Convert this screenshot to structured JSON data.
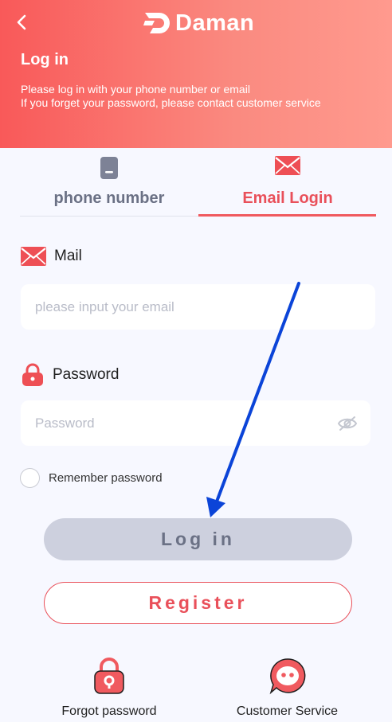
{
  "header": {
    "logo_text": "Daman",
    "title": "Log in",
    "subtitle_line1": "Please log in with your phone number or email",
    "subtitle_line2": "If you forget your password, please contact customer service"
  },
  "tabs": [
    {
      "label": "phone number",
      "active": false
    },
    {
      "label": "Email Login",
      "active": true
    }
  ],
  "mail": {
    "label": "Mail",
    "placeholder": "please input your email",
    "value": ""
  },
  "password": {
    "label": "Password",
    "placeholder": "Password",
    "value": ""
  },
  "remember": {
    "label": "Remember password",
    "checked": false
  },
  "buttons": {
    "login": "Log in",
    "register": "Register"
  },
  "links": {
    "forgot": "Forgot password",
    "service": "Customer Service"
  },
  "colors": {
    "accent": "#e9505a",
    "header_start": "#f95959",
    "header_end": "#ff9a8e",
    "annotation_arrow": "#0b44d8"
  }
}
